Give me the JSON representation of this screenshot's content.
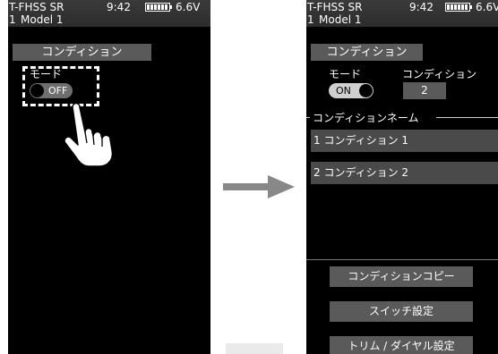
{
  "left_screen": {
    "status": {
      "model_code": "T-FHSS SR",
      "time": "9:42",
      "voltage": "6.6V",
      "model_number": "1",
      "model_name": "Model 1",
      "battery_level": 1.0
    },
    "title": "コンディション",
    "mode_label": "モード",
    "mode_toggle_text": "OFF"
  },
  "right_screen": {
    "status": {
      "model_code": "T-FHSS SR",
      "time": "9:42",
      "voltage": "6.6V",
      "model_number": "1",
      "model_name": "Model 1",
      "battery_level": 1.0
    },
    "title": "コンディション",
    "mode_label": "モード",
    "condition_label": "コンディション",
    "mode_toggle_text": "ON",
    "condition_value": "2",
    "section_label": "コンディションネーム",
    "conditions": [
      {
        "label": "1 コンディション 1"
      },
      {
        "label": "2 コンディション 2"
      }
    ],
    "buttons": {
      "copy": "コンディションコピー",
      "switch": "スイッチ設定",
      "trim": "トリム / ダイヤル設定"
    }
  },
  "colors": {
    "screen_bg": "#000000",
    "bar_gray": "#5a5a5a",
    "list_gray": "#4a4a4a",
    "arrow": "#888888"
  },
  "icons": {
    "gesture": "pointing-hand-icon",
    "transition": "arrow-right-icon",
    "battery": "battery-icon"
  }
}
